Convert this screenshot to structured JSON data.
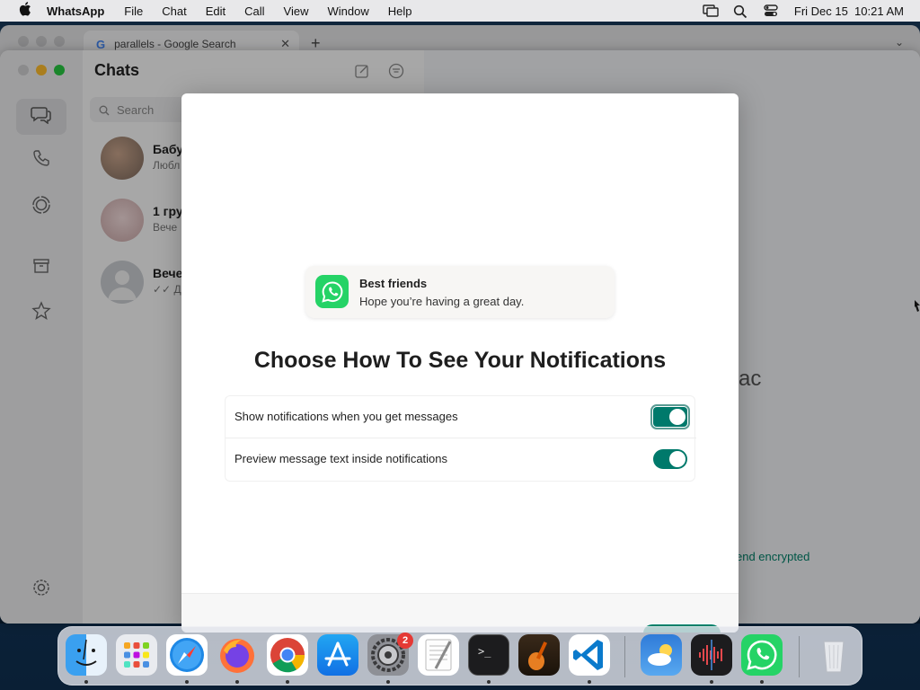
{
  "menubar": {
    "app_name": "WhatsApp",
    "items": [
      "File",
      "Chat",
      "Edit",
      "Call",
      "View",
      "Window",
      "Help"
    ],
    "datetime": "Fri Dec 15  10:21 AM",
    "status_icons": [
      "screen-mirror-icon",
      "spotlight-search-icon",
      "control-center-icon"
    ]
  },
  "browser": {
    "tab_title": "parallels - Google Search",
    "tab_favicon": "G"
  },
  "whatsapp": {
    "title": "Chats",
    "search_placeholder": "Search",
    "rail_icons": [
      "chats-icon",
      "calls-icon",
      "status-icon",
      "archive-icon",
      "starred-icon",
      "settings-icon"
    ],
    "chats": [
      {
        "name": "Бабу",
        "preview": "Любл"
      },
      {
        "name": "1 гру",
        "preview": "Вече"
      },
      {
        "name": "Вече",
        "preview": "✓✓ Д"
      }
    ],
    "right_partial_title": "ac",
    "encrypted_partial": "end encrypted"
  },
  "modal": {
    "notification": {
      "title": "Best friends",
      "body": "Hope you’re having a great day."
    },
    "heading": "Choose How To See Your Notifications",
    "options": [
      {
        "label": "Show notifications when you get messages",
        "enabled": true
      },
      {
        "label": "Preview message text inside notifications",
        "enabled": true
      }
    ]
  },
  "dock": {
    "apps": [
      "Finder",
      "Launchpad",
      "Safari",
      "Firefox",
      "Chrome",
      "App Store",
      "System Preferences",
      "TextEdit",
      "Terminal",
      "GarageBand",
      "Visual Studio Code",
      "Weather",
      "Voice Memos",
      "WhatsApp",
      "Trash"
    ],
    "system_preferences_badge": "2"
  },
  "colors": {
    "accent": "#00796b",
    "whatsapp_green": "#25d366",
    "menubar_bg": "#e8e8ea"
  }
}
